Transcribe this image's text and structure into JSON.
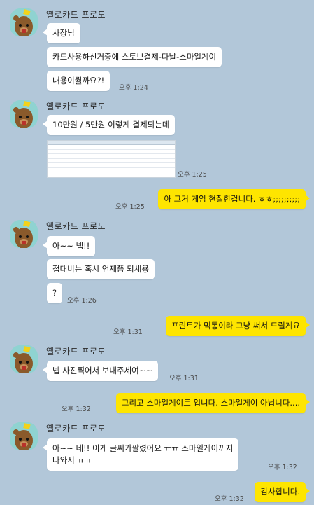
{
  "colors": {
    "background": "#b2c7d9",
    "incoming_bubble": "#ffffff",
    "outgoing_bubble": "#fee500",
    "avatar_bg": "#8fd3d1"
  },
  "sender_name": "옐로카드 프로도",
  "messages": {
    "m1": "사장님",
    "m2": "카드사용하신거중에 스토브결제-다날-스마일게이",
    "m3": "내용이뭘까요?!",
    "t1": "오후 1:24",
    "m4": "10만원 / 5만원 이렇게 결제되는데",
    "t2": "오후 1:25",
    "o1": "아 그거 게임 현질한겁니다. ㅎㅎ;;;;;;;;;;",
    "to1": "오후 1:25",
    "m5": "아~~ 넵!!",
    "m6": "접대비는 혹시 언제쯤 되세용",
    "m7": "?",
    "t3": "오후 1:26",
    "o2": "프린트가 먹통이라 그냥 써서 드릴게요",
    "to2": "오후 1:31",
    "m8": "넵 사진찍어서 보내주세여~~",
    "t4": "오후 1:31",
    "o3": "그리고 스마일게이트 입니다. 스마일게이 아닙니다....",
    "to3": "오후 1:32",
    "m9_line1": "아~~ 네!! 이게 글씨가짤렸어요 ㅠㅠ 스마일게이까지",
    "m9_line2": "나와서 ㅠㅠ",
    "t5": "오후 1:32",
    "o4": "감사합니다.",
    "to4": "오후 1:32"
  },
  "attachment_icon": "spreadsheet-screenshot-icon"
}
